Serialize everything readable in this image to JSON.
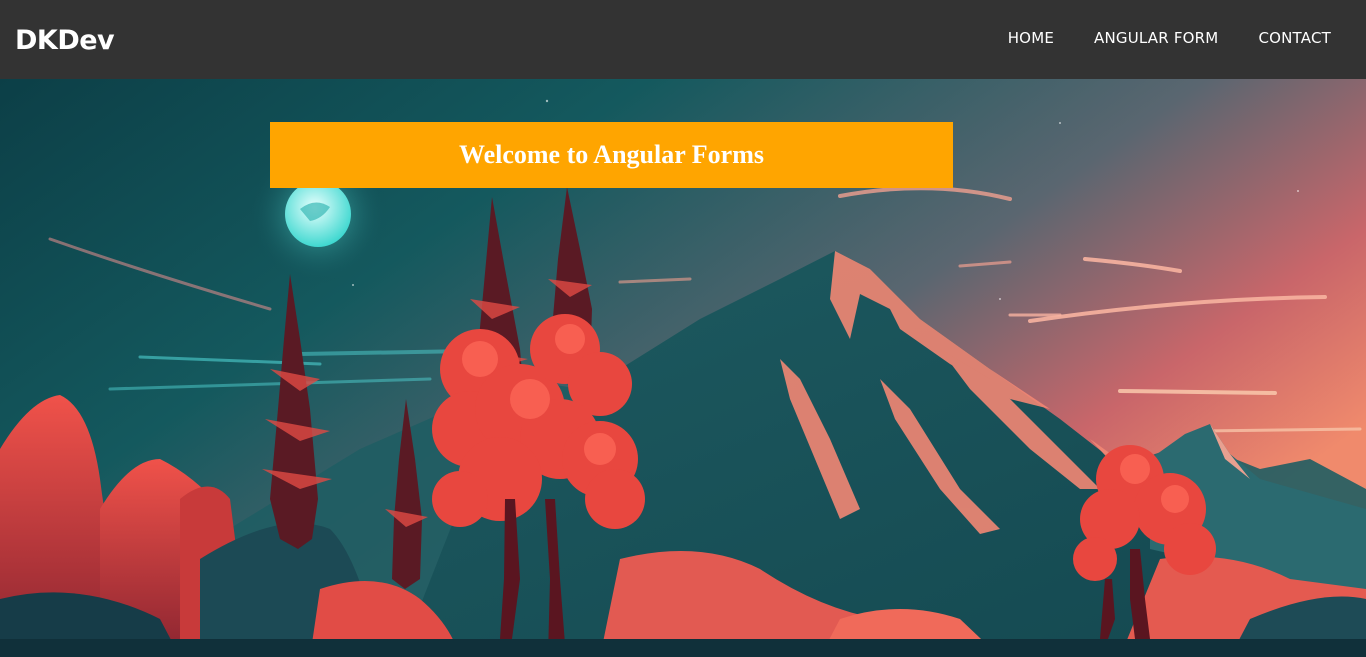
{
  "app": {
    "brand": "DKDev"
  },
  "nav": {
    "items": [
      {
        "label": "HOME"
      },
      {
        "label": "ANGULAR FORM"
      },
      {
        "label": "CONTACT"
      }
    ]
  },
  "banner": {
    "title": "Welcome to Angular Forms"
  },
  "colors": {
    "navbar_bg": "#333333",
    "banner_bg": "#ffa500",
    "text_light": "#ffffff",
    "sky_top": "#0e4a52",
    "sky_glow": "#f27d6a",
    "foliage": "#e8453c",
    "moon": "#9ff5f2"
  },
  "hero": {
    "image": "illustrated-mountain-landscape"
  }
}
